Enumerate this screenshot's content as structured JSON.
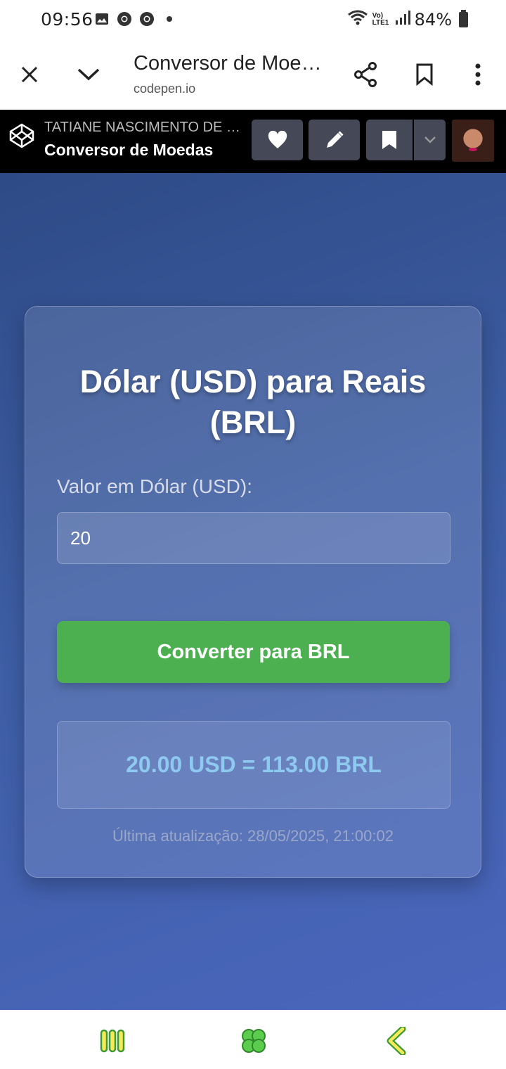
{
  "status_bar": {
    "time": "09:56",
    "network": "Vo) LTE1",
    "battery": "84%"
  },
  "browser": {
    "title": "Conversor de Moedas",
    "url": "codepen.io"
  },
  "codepen": {
    "author": "TATIANE NASCIMENTO DE SOUZA",
    "pen_title": "Conversor de Moedas"
  },
  "converter": {
    "title": "Dólar (USD) para Reais (BRL)",
    "input_label": "Valor em Dólar (USD):",
    "input_value": "20",
    "button_label": "Converter para BRL",
    "result": "20.00 USD = 113.00 BRL",
    "last_update": "Última atualização: 28/05/2025, 21:00:02"
  },
  "colors": {
    "button_green": "#4caf50",
    "result_text": "#8ec9f0",
    "nav_icon_green": "#5ccc4e",
    "nav_icon_yellow": "#f4ea5a"
  },
  "icons": {
    "nav": [
      "recent-apps-icon",
      "home-clover-icon",
      "back-icon"
    ]
  }
}
